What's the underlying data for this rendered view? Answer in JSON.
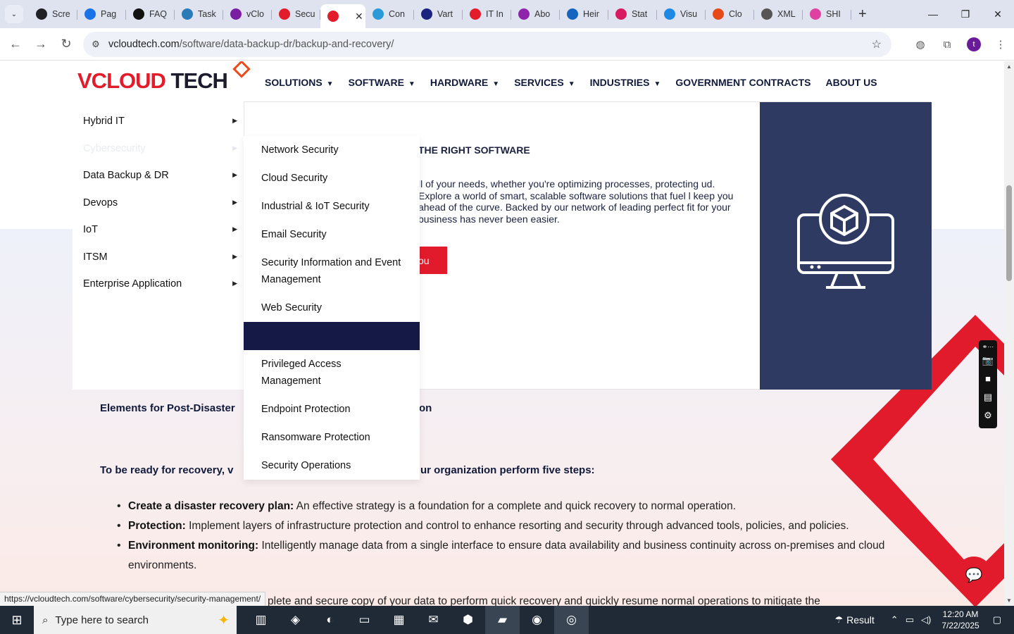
{
  "browser": {
    "tabs": [
      {
        "label": "Scre",
        "color": "#202124"
      },
      {
        "label": "Pag",
        "color": "#1a73e8"
      },
      {
        "label": "FAQ",
        "color": "#111111"
      },
      {
        "label": "Task",
        "color": "#2b7bb9"
      },
      {
        "label": "vClo",
        "color": "#7a1fa2"
      },
      {
        "label": "Secu",
        "color": "#e31c2b"
      },
      {
        "label": "",
        "color": "#e31c2b",
        "active": true
      },
      {
        "label": "Con",
        "color": "#2a9bd8"
      },
      {
        "label": "Vart",
        "color": "#1a237e"
      },
      {
        "label": "IT In",
        "color": "#e31c2b"
      },
      {
        "label": "Abo",
        "color": "#8e24aa"
      },
      {
        "label": "Heir",
        "color": "#1565c0"
      },
      {
        "label": "Stat",
        "color": "#d81b60"
      },
      {
        "label": "Visu",
        "color": "#1e88e5"
      },
      {
        "label": "Clo",
        "color": "#e64a19"
      },
      {
        "label": "XML",
        "color": "#555555"
      },
      {
        "label": "SHI",
        "color": "#e040a0"
      }
    ],
    "url_host": "vcloudtech.com",
    "url_path": "/software/data-backup-dr/backup-and-recovery/",
    "profile_initial": "t",
    "status_url": "https://vcloudtech.com/software/cybersecurity/security-management/"
  },
  "site": {
    "logo_v": "VCLOUD",
    "logo_tech": "TECH",
    "nav": [
      {
        "label": "SOLUTIONS",
        "caret": true
      },
      {
        "label": "SOFTWARE",
        "caret": true
      },
      {
        "label": "HARDWARE",
        "caret": true
      },
      {
        "label": "SERVICES",
        "caret": true
      },
      {
        "label": "INDUSTRIES",
        "caret": true
      },
      {
        "label": "GOVERNMENT CONTRACTS",
        "caret": false
      },
      {
        "label": "ABOUT US",
        "caret": false
      }
    ],
    "software_menu": [
      "Hybrid IT",
      "Cybersecurity",
      "Data Backup & DR",
      "Devops",
      "IoT",
      "ITSM",
      "Enterprise Application"
    ],
    "cyber_menu": [
      "Network Security",
      "Cloud Security",
      "Industrial & IoT Security",
      "Email Security",
      "Security Information and Event Management",
      "Web Security",
      "",
      "Privileged Access Management",
      "Endpoint Protection",
      "Ransomware Protection",
      "Security Operations"
    ],
    "hero_heading": "THE RIGHT SOFTWARE",
    "hero_text": "ll of your needs, whether you're optimizing processes, protecting ud. Explore a world of smart, scalable software solutions that fuel l keep you ahead of the curve. Backed by our network of leading perfect fit for your business has never been easier.",
    "hero_button": "ou",
    "section_title_start": "Elements for Post-Disaster",
    "section_title_end": "on",
    "steps_head_start": "To be ready for recovery, v",
    "steps_head_end": "ur organization perform five steps:",
    "steps": [
      {
        "bold": "Create a disaster recovery plan:",
        "text": " An effective strategy is a foundation for a complete and quick recovery to normal operation."
      },
      {
        "bold": "Protection:",
        "text": " Implement layers of infrastructure protection and control to enhance resorting and security through advanced tools, policies, and policies."
      },
      {
        "bold": "Environment monitoring:",
        "text": " Intelligently manage data from a single interface to ensure data availability and business continuity across on-premises and cloud environments."
      }
    ],
    "step_partial": "plete and secure copy of your data to perform quick recovery and quickly resume normal operations to mitigate the"
  },
  "taskbar": {
    "search_placeholder": "Type here to search",
    "tray_label": "Result",
    "time": "12:20 AM",
    "date": "7/22/2025"
  },
  "colors": {
    "brand_red": "#e11b2c",
    "navy": "#2f3a63",
    "menu_highlight": "#141a45"
  }
}
